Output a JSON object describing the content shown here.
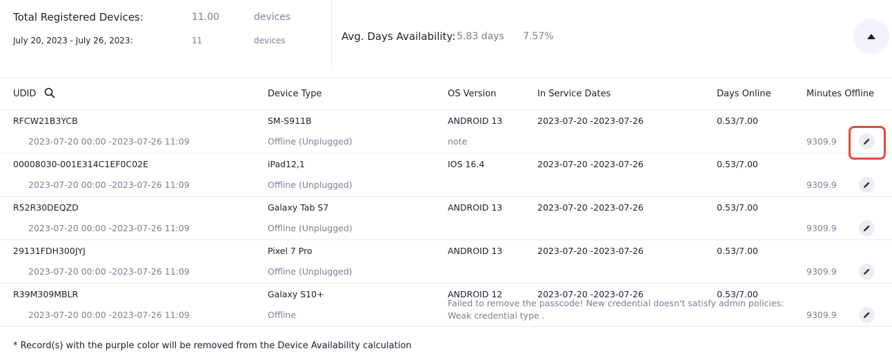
{
  "summary": {
    "total_label": "Total Registered Devices:",
    "total_value": "11.00",
    "total_unit": "devices",
    "range_label": "July 20, 2023 - July 26, 2023:",
    "range_value": "11",
    "range_unit": "devices",
    "avg_label": "Avg. Days Availability:",
    "avg_days": "5.83 days",
    "avg_percent": "7.57%",
    "collapse_icon": "caret-up-icon"
  },
  "table": {
    "columns": [
      "UDID",
      "Device Type",
      "OS Version",
      "In Service Dates",
      "Days Online",
      "Minutes Offline"
    ],
    "rows": [
      {
        "udid": "RFCW21B3YCB",
        "range": "2023-07-20 00:00 -2023-07-26 11:09",
        "device_type": "SM-S911B",
        "status": "Offline (Unplugged)",
        "os": "ANDROID 13",
        "note": "note",
        "service_dates": "2023-07-20 -2023-07-26",
        "days_online": "0.53/7.00",
        "minutes_offline": "9309.9"
      },
      {
        "udid": "00008030-001E314C1EF0C02E",
        "range": "2023-07-20 00:00 -2023-07-26 11:09",
        "device_type": "iPad12,1",
        "status": "Offline (Unplugged)",
        "os": "IOS 16.4",
        "note": "",
        "service_dates": "2023-07-20 -2023-07-26",
        "days_online": "0.53/7.00",
        "minutes_offline": "9309.9"
      },
      {
        "udid": "R52R30DEQZD",
        "range": "2023-07-20 00:00 -2023-07-26 11:09",
        "device_type": "Galaxy Tab S7",
        "status": "Offline (Unplugged)",
        "os": "ANDROID 13",
        "note": "",
        "service_dates": "2023-07-20 -2023-07-26",
        "days_online": "0.53/7.00",
        "minutes_offline": "9309.9"
      },
      {
        "udid": "29131FDH300JYJ",
        "range": "2023-07-20 00:00 -2023-07-26 11:09",
        "device_type": "Pixel 7 Pro",
        "status": "Offline (Unplugged)",
        "os": "ANDROID 13",
        "note": "",
        "service_dates": "2023-07-20 -2023-07-26",
        "days_online": "0.53/7.00",
        "minutes_offline": "9309.9"
      },
      {
        "udid": "R39M309MBLR",
        "range": "2023-07-20 00:00 -2023-07-26 11:09",
        "device_type": "Galaxy S10+",
        "status": "Offline",
        "os": "ANDROID 12",
        "note": "Failed to remove the passcode! New credential doesn't satisfy admin policies: Weak credential type .",
        "service_dates": "2023-07-20 -2023-07-26",
        "days_online": "0.53/7.00",
        "minutes_offline": "9309.9"
      }
    ]
  },
  "footnote": "* Record(s) with the purple color will be removed from the Device Availability calculation",
  "colors": {
    "accent_highlight": "#e5483b",
    "muted_text": "#7a7f94",
    "button_bg": "#f3f3fb"
  }
}
